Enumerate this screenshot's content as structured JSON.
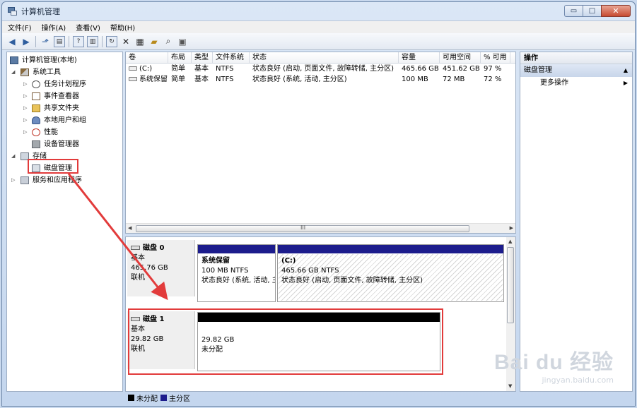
{
  "window": {
    "title": "计算机管理"
  },
  "window_controls": {
    "minimize": "▭",
    "maximize": "□",
    "close": "✕"
  },
  "menu": [
    "文件(F)",
    "操作(A)",
    "查看(V)",
    "帮助(H)"
  ],
  "tree": [
    {
      "label": "计算机管理(本地)",
      "level": 0,
      "twisty": "",
      "icon": "computer-icon"
    },
    {
      "label": "系统工具",
      "level": 1,
      "twisty": "◢",
      "icon": "tools-icon"
    },
    {
      "label": "任务计划程序",
      "level": 2,
      "twisty": "▷",
      "icon": "clock-icon"
    },
    {
      "label": "事件查看器",
      "level": 2,
      "twisty": "▷",
      "icon": "event-log-icon"
    },
    {
      "label": "共享文件夹",
      "level": 2,
      "twisty": "▷",
      "icon": "shared-folder-icon"
    },
    {
      "label": "本地用户和组",
      "level": 2,
      "twisty": "▷",
      "icon": "users-icon"
    },
    {
      "label": "性能",
      "level": 2,
      "twisty": "▷",
      "icon": "performance-icon"
    },
    {
      "label": "设备管理器",
      "level": 2,
      "twisty": "",
      "icon": "device-manager-icon"
    },
    {
      "label": "存储",
      "level": 1,
      "twisty": "◢",
      "icon": "storage-icon"
    },
    {
      "label": "磁盘管理",
      "level": 2,
      "twisty": "",
      "icon": "disk-management-icon"
    },
    {
      "label": "服务和应用程序",
      "level": 1,
      "twisty": "▷",
      "icon": "services-icon"
    }
  ],
  "volumes": {
    "headers": [
      "卷",
      "布局",
      "类型",
      "文件系统",
      "状态",
      "容量",
      "可用空间",
      "% 可用"
    ],
    "rows": [
      [
        "(C:)",
        "简单",
        "基本",
        "NTFS",
        "状态良好 (启动, 页面文件, 故障转储, 主分区)",
        "465.66 GB",
        "451.62 GB",
        "97 %"
      ],
      [
        "系统保留",
        "简单",
        "基本",
        "NTFS",
        "状态良好 (系统, 活动, 主分区)",
        "100 MB",
        "72 MB",
        "72 %"
      ]
    ],
    "scroll_grip": "III"
  },
  "disks": [
    {
      "name": "磁盘 0",
      "type": "基本",
      "size": "465.76 GB",
      "status": "联机",
      "partitions": [
        {
          "name": "系统保留",
          "size": "100 MB NTFS",
          "status": "状态良好 (系统, 活动, 主分区)"
        },
        {
          "name": "(C:)",
          "size": "465.66 GB NTFS",
          "status": "状态良好 (启动, 页面文件, 故障转储, 主分区)"
        }
      ]
    },
    {
      "name": "磁盘 1",
      "type": "基本",
      "size": "29.82 GB",
      "status": "联机",
      "partitions": [
        {
          "name": "",
          "size": "29.82 GB",
          "status": "未分配"
        }
      ]
    }
  ],
  "legend": [
    {
      "label": "未分配",
      "color": "#000000"
    },
    {
      "label": "主分区",
      "color": "#1c1c8c"
    }
  ],
  "actions": {
    "header": "操作",
    "section": "磁盘管理",
    "more": "更多操作"
  },
  "colors": {
    "highlight": "#e23b3b",
    "primary_partition": "#1c1c8c",
    "unallocated": "#000000"
  },
  "watermark": {
    "main": "Bai du 经验",
    "sub": "jingyan.baidu.com"
  }
}
